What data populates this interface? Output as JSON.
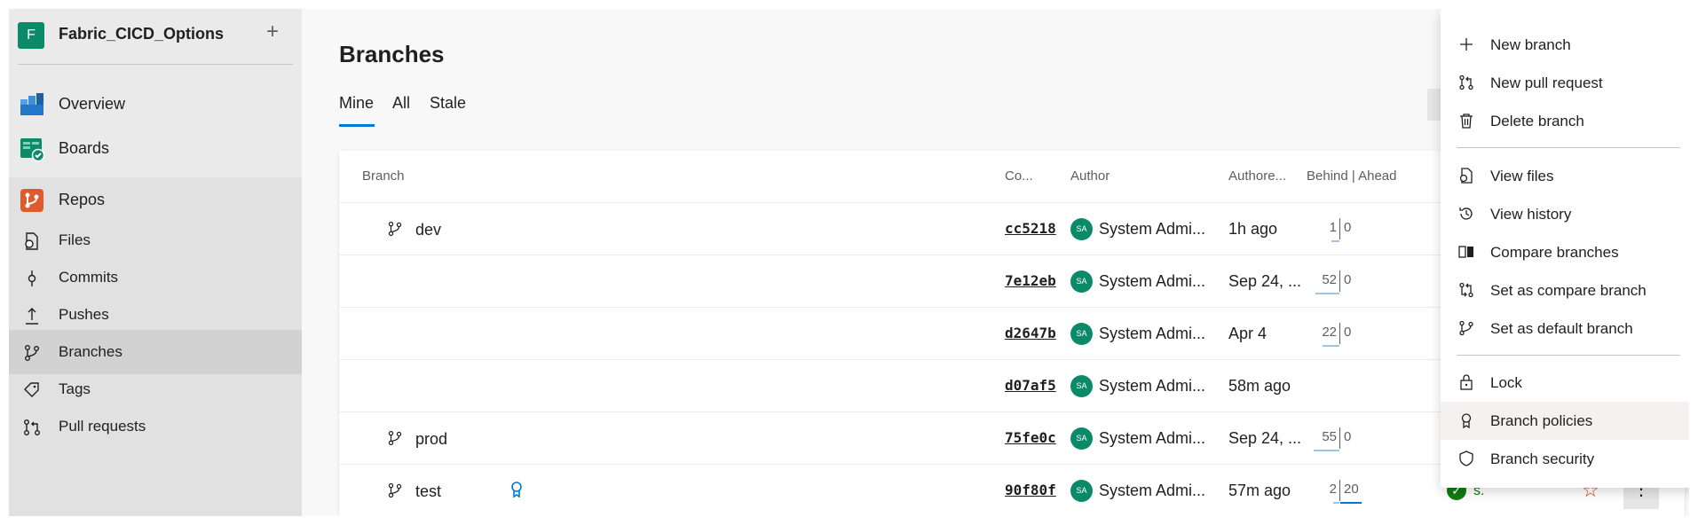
{
  "project": {
    "avatar_letter": "F",
    "name": "Fabric_CICD_Options",
    "add": "+"
  },
  "nav": {
    "overview": "Overview",
    "boards": "Boards",
    "repos": "Repos",
    "files": "Files",
    "commits": "Commits",
    "pushes": "Pushes",
    "branches": "Branches",
    "tags": "Tags",
    "pull_requests": "Pull requests"
  },
  "page": {
    "title": "Branches",
    "tabs": [
      "Mine",
      "All",
      "Stale"
    ]
  },
  "table": {
    "headers": {
      "branch": "Branch",
      "commit": "Co...",
      "author": "Author",
      "authored": "Authore...",
      "behind_ahead": "Behind | Ahead"
    },
    "rows": [
      {
        "name": "dev",
        "commit": "cc5218",
        "initials": "SA",
        "author": "System Admi...",
        "authored": "1h ago",
        "behind": "1",
        "ahead": "0"
      },
      {
        "name": "",
        "commit": "7e12eb",
        "initials": "SA",
        "author": "System Admi...",
        "authored": "Sep 24, ...",
        "behind": "52",
        "ahead": "0"
      },
      {
        "name": "",
        "commit": "d2647b",
        "initials": "SA",
        "author": "System Admi...",
        "authored": "Apr 4",
        "behind": "22",
        "ahead": "0"
      },
      {
        "name": "",
        "commit": "d07af5",
        "initials": "SA",
        "author": "System Admi...",
        "authored": "58m ago",
        "behind": "",
        "ahead": ""
      },
      {
        "name": "prod",
        "commit": "75fe0c",
        "initials": "SA",
        "author": "System Admi...",
        "authored": "Sep 24, ...",
        "behind": "55",
        "ahead": "0"
      },
      {
        "name": "test",
        "commit": "90f80f",
        "initials": "SA",
        "author": "System Admi...",
        "authored": "57m ago",
        "behind": "2",
        "ahead": "20",
        "pipeline": "s.",
        "more": "⋮"
      }
    ]
  },
  "menu": {
    "new_branch": "New branch",
    "new_pull_request": "New pull request",
    "delete_branch": "Delete branch",
    "view_files": "View files",
    "view_history": "View history",
    "compare_branches": "Compare branches",
    "set_compare": "Set as compare branch",
    "set_default": "Set as default branch",
    "lock": "Lock",
    "branch_policies": "Branch policies",
    "branch_security": "Branch security"
  },
  "colors": {
    "accent": "#0078d4",
    "success": "#107c10",
    "star": "#ca5010",
    "avatar": "#0b8a6a"
  }
}
